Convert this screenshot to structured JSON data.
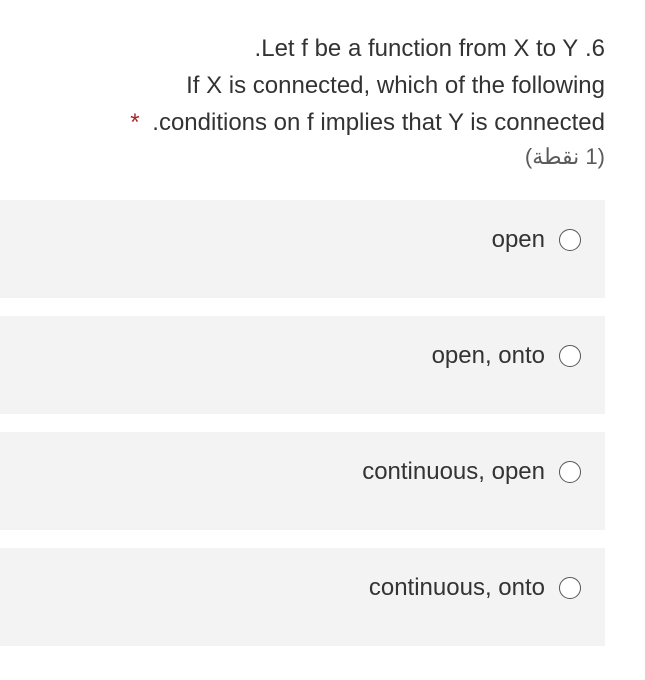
{
  "question": {
    "text_line1": "6. Let f be a function from X to Y.",
    "text_line2": "If X is connected, which of the following",
    "text_line3": "conditions on f implies that Y is connected.",
    "required_star": "*",
    "points": "(1 نقطة)"
  },
  "options": [
    {
      "label": "open"
    },
    {
      "label": "open, onto"
    },
    {
      "label": "continuous, open"
    },
    {
      "label": "continuous, onto"
    }
  ]
}
